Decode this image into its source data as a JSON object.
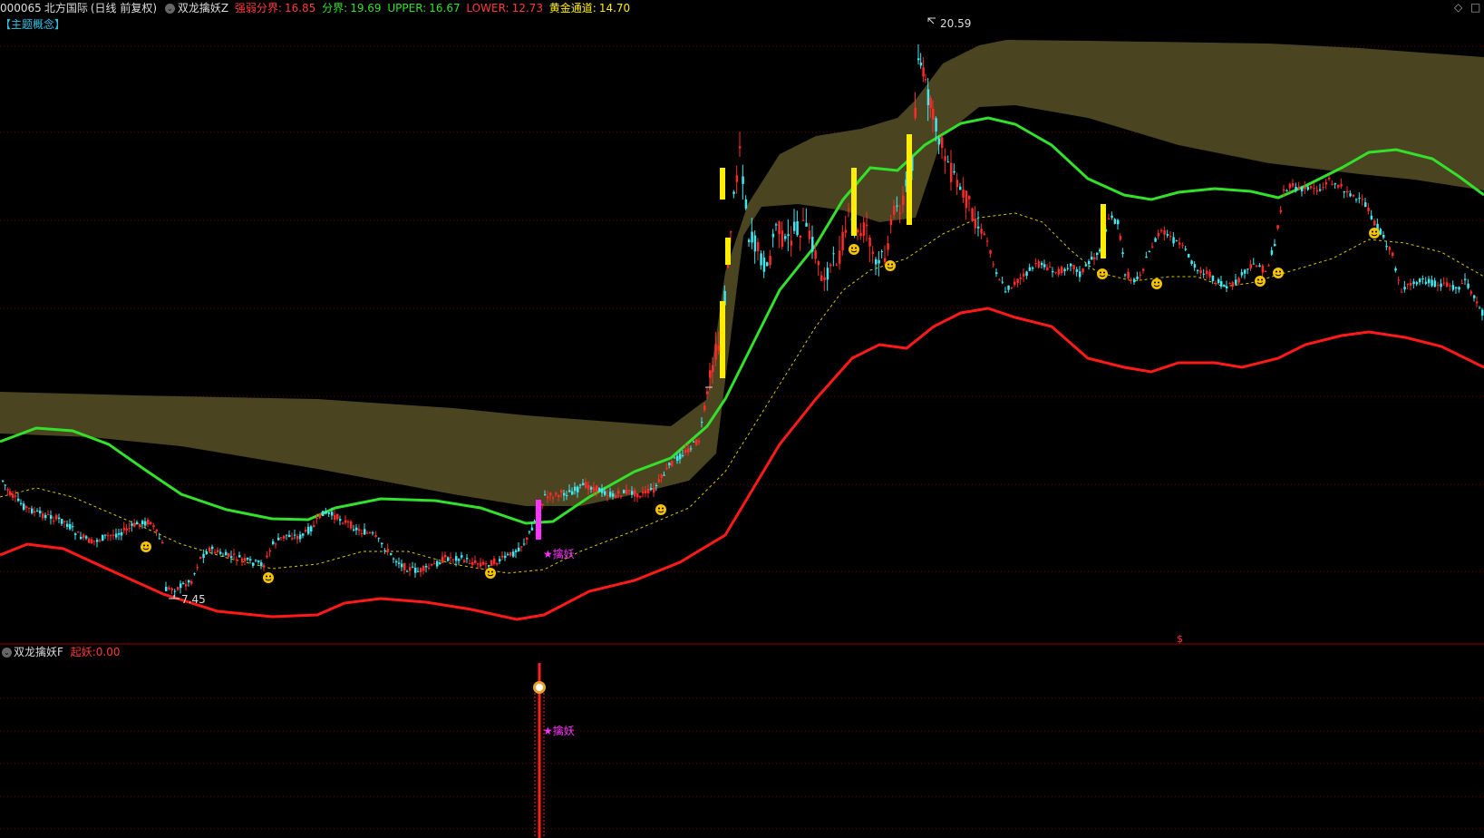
{
  "header": {
    "symbol": "000065",
    "name": "北方国际",
    "period": "(日线 前复权)",
    "indicator_name": "双龙擒妖Z",
    "weak_label": "强弱分界:",
    "weak_value": "16.85",
    "split_label": "分界:",
    "split_value": "19.69",
    "upper_label": "UPPER:",
    "upper_value": "16.67",
    "lower_label": "LOWER:",
    "lower_value": "12.73",
    "gold_label": "黄金通道:",
    "gold_value": "14.70"
  },
  "topic_label": "【主题概念】",
  "annotations": {
    "high_price": "20.59",
    "low_price": "7.45",
    "signal_label": "★擒妖",
    "dollar_marker": "$"
  },
  "sub_panel": {
    "indicator_name": "双龙擒妖F",
    "param_label": "起妖:",
    "param_value": "0.00",
    "signal_label": "★擒妖",
    "coin_icon": "money-bag-icon"
  },
  "window_controls": {
    "diamond": "◇",
    "restore": "□"
  },
  "colors": {
    "background": "#000000",
    "up_candle": "#ff2a2a",
    "down_candle": "#3fe9f2",
    "green_line": "#33e02b",
    "red_line": "#ff1a1a",
    "band_fill": "#4a4420",
    "dotted_line": "#d8c400",
    "yellow_bar": "#ffee00",
    "magenta_bar": "#ff33ff",
    "grid": "#6a0000",
    "smiley": "#f4c400"
  }
}
